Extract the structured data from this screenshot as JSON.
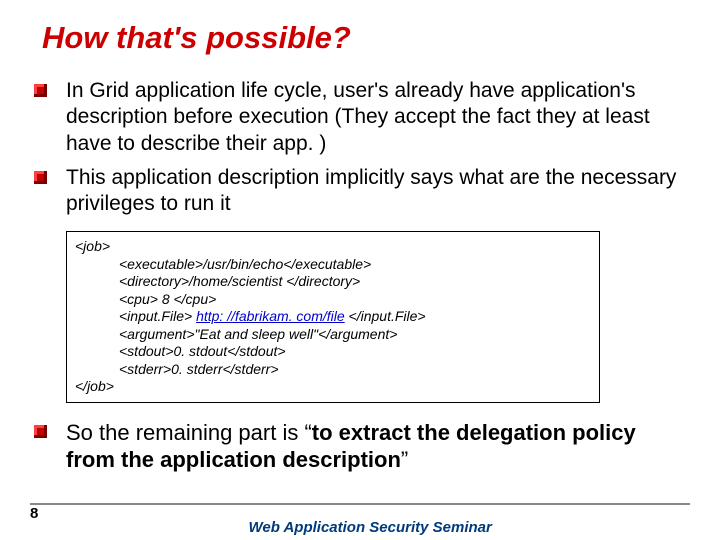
{
  "title": "How that's possible?",
  "bullets_top": [
    "In Grid application life cycle, user's already have application's description before execution (They accept the fact they at least have to describe their app. )",
    "This application description implicitly says what are the necessary privileges to run it"
  ],
  "code": {
    "open": "<job>",
    "lines": [
      "<executable>/usr/bin/echo</executable>",
      "<directory>/home/scientist </directory>",
      "<cpu> 8 </cpu>",
      {
        "pre": "<input.File> ",
        "link": "http: //fabrikam. com/file",
        "post": " </input.File>"
      },
      "<argument>\"Eat and sleep well\"</argument>",
      "<stdout>0. stdout</stdout>",
      "<stderr>0. stderr</stderr>"
    ],
    "close": "</job>"
  },
  "bullets_bottom": [
    {
      "pre": "So the remaining part is “",
      "bold": "to extract the delegation policy from the application description",
      "post": "”"
    }
  ],
  "footer": {
    "page": "8",
    "title": "Web Application Security Seminar"
  }
}
